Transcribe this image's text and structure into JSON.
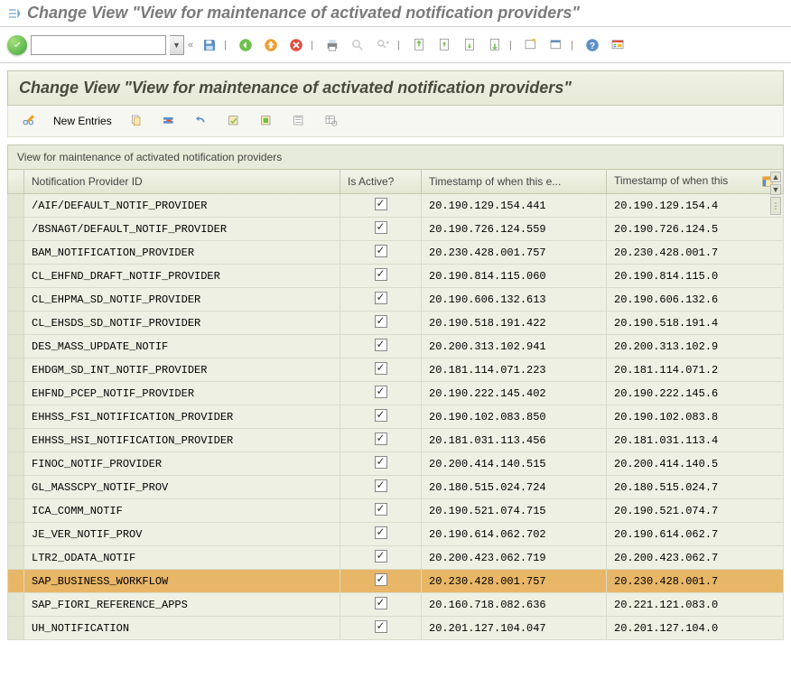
{
  "window": {
    "title": "Change View \"View for maintenance of activated notification providers\""
  },
  "panel": {
    "title": "Change View \"View for maintenance of activated notification providers\""
  },
  "subtoolbar": {
    "new_entries": "New Entries"
  },
  "grid": {
    "title": "View for maintenance of activated notification providers",
    "columns": {
      "id": "Notification Provider ID",
      "active": "Is Active?",
      "ts1": "Timestamp of when this e...",
      "ts2": "Timestamp of when this"
    },
    "rows": [
      {
        "id": "/AIF/DEFAULT_NOTIF_PROVIDER",
        "active": true,
        "ts1": "20.190.129.154.441",
        "ts2": "20.190.129.154.4",
        "hl": false
      },
      {
        "id": "/BSNAGT/DEFAULT_NOTIF_PROVIDER",
        "active": true,
        "ts1": "20.190.726.124.559",
        "ts2": "20.190.726.124.5",
        "hl": false
      },
      {
        "id": "BAM_NOTIFICATION_PROVIDER",
        "active": true,
        "ts1": "20.230.428.001.757",
        "ts2": "20.230.428.001.7",
        "hl": false
      },
      {
        "id": "CL_EHFND_DRAFT_NOTIF_PROVIDER",
        "active": true,
        "ts1": "20.190.814.115.060",
        "ts2": "20.190.814.115.0",
        "hl": false
      },
      {
        "id": "CL_EHPMA_SD_NOTIF_PROVIDER",
        "active": true,
        "ts1": "20.190.606.132.613",
        "ts2": "20.190.606.132.6",
        "hl": false
      },
      {
        "id": "CL_EHSDS_SD_NOTIF_PROVIDER",
        "active": true,
        "ts1": "20.190.518.191.422",
        "ts2": "20.190.518.191.4",
        "hl": false
      },
      {
        "id": "DES_MASS_UPDATE_NOTIF",
        "active": true,
        "ts1": "20.200.313.102.941",
        "ts2": "20.200.313.102.9",
        "hl": false
      },
      {
        "id": "EHDGM_SD_INT_NOTIF_PROVIDER",
        "active": true,
        "ts1": "20.181.114.071.223",
        "ts2": "20.181.114.071.2",
        "hl": false
      },
      {
        "id": "EHFND_PCEP_NOTIF_PROVIDER",
        "active": true,
        "ts1": "20.190.222.145.402",
        "ts2": "20.190.222.145.6",
        "hl": false
      },
      {
        "id": "EHHSS_FSI_NOTIFICATION_PROVIDER",
        "active": true,
        "ts1": "20.190.102.083.850",
        "ts2": "20.190.102.083.8",
        "hl": false
      },
      {
        "id": "EHHSS_HSI_NOTIFICATION_PROVIDER",
        "active": true,
        "ts1": "20.181.031.113.456",
        "ts2": "20.181.031.113.4",
        "hl": false
      },
      {
        "id": "FINOC_NOTIF_PROVIDER",
        "active": true,
        "ts1": "20.200.414.140.515",
        "ts2": "20.200.414.140.5",
        "hl": false
      },
      {
        "id": "GL_MASSCPY_NOTIF_PROV",
        "active": true,
        "ts1": "20.180.515.024.724",
        "ts2": "20.180.515.024.7",
        "hl": false
      },
      {
        "id": "ICA_COMM_NOTIF",
        "active": true,
        "ts1": "20.190.521.074.715",
        "ts2": "20.190.521.074.7",
        "hl": false
      },
      {
        "id": "JE_VER_NOTIF_PROV",
        "active": true,
        "ts1": "20.190.614.062.702",
        "ts2": "20.190.614.062.7",
        "hl": false
      },
      {
        "id": "LTR2_ODATA_NOTIF",
        "active": true,
        "ts1": "20.200.423.062.719",
        "ts2": "20.200.423.062.7",
        "hl": false
      },
      {
        "id": "SAP_BUSINESS_WORKFLOW",
        "active": true,
        "ts1": "20.230.428.001.757",
        "ts2": "20.230.428.001.7",
        "hl": true
      },
      {
        "id": "SAP_FIORI_REFERENCE_APPS",
        "active": true,
        "ts1": "20.160.718.082.636",
        "ts2": "20.221.121.083.0",
        "hl": false
      },
      {
        "id": "UH_NOTIFICATION",
        "active": true,
        "ts1": "20.201.127.104.047",
        "ts2": "20.201.127.104.0",
        "hl": false
      }
    ]
  }
}
